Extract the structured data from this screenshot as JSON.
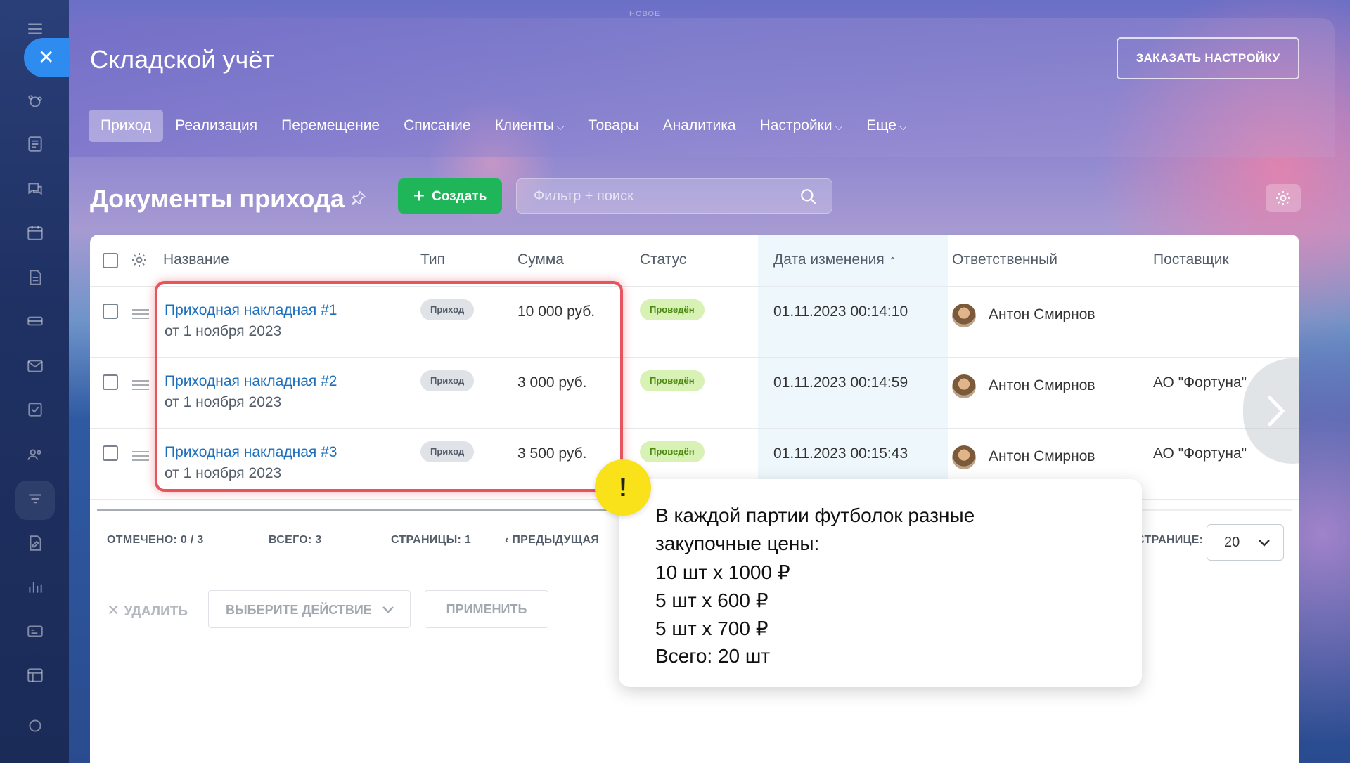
{
  "top_tag": "НОВОЕ",
  "panel": {
    "title": "Складской учёт",
    "order_setup_label": "ЗАКАЗАТЬ НАСТРОЙКУ"
  },
  "tabs": [
    {
      "label": "Приход",
      "active": true
    },
    {
      "label": "Реализация"
    },
    {
      "label": "Перемещение"
    },
    {
      "label": "Списание"
    },
    {
      "label": "Клиенты",
      "dropdown": true
    },
    {
      "label": "Товары"
    },
    {
      "label": "Аналитика"
    },
    {
      "label": "Настройки",
      "dropdown": true
    },
    {
      "label": "Еще",
      "dropdown": true
    }
  ],
  "section": {
    "title": "Документы прихода",
    "create_label": "Создать",
    "search_placeholder": "Фильтр + поиск"
  },
  "table": {
    "headers": {
      "name": "Название",
      "type": "Тип",
      "sum": "Сумма",
      "status": "Статус",
      "date": "Дата изменения",
      "responsible": "Ответственный",
      "supplier": "Поставщик"
    },
    "rows": [
      {
        "name": "Приходная накладная #1",
        "date_sub": "от 1 ноября 2023",
        "type": "Приход",
        "sum": "10 000 руб.",
        "status": "Проведён",
        "modified": "01.11.2023 00:14:10",
        "responsible": "Антон Смирнов",
        "supplier": ""
      },
      {
        "name": "Приходная накладная #2",
        "date_sub": "от 1 ноября 2023",
        "type": "Приход",
        "sum": "3 000 руб.",
        "status": "Проведён",
        "modified": "01.11.2023 00:14:59",
        "responsible": "Антон Смирнов",
        "supplier": "АО \"Фортуна\""
      },
      {
        "name": "Приходная накладная #3",
        "date_sub": "от 1 ноября 2023",
        "type": "Приход",
        "sum": "3 500 руб.",
        "status": "Проведён",
        "modified": "01.11.2023 00:15:43",
        "responsible": "Антон Смирнов",
        "supplier": "АО \"Фортуна\""
      }
    ]
  },
  "footer": {
    "selected": "ОТМЕЧЕНО: 0 / 3",
    "total": "ВСЕГО: 3",
    "pages": "СТРАНИЦЫ:  1",
    "prev": "ПРЕДЫДУЩАЯ",
    "per_page_label": "СТРАНИЦЕ:",
    "per_page_value": "20"
  },
  "actions": {
    "delete_label": "УДАЛИТЬ",
    "select_action_label": "ВЫБЕРИТЕ ДЕЙСТВИЕ",
    "apply_label": "ПРИМЕНИТЬ"
  },
  "tooltip": {
    "badge": "!",
    "lines": [
      "В каждой партии футболок разные",
      "закупочные цены:",
      "10 шт х 1000 ₽",
      "5 шт х 600 ₽",
      "5 шт х 700 ₽",
      "Всего: 20 шт"
    ]
  },
  "colors": {
    "accent": "#2e8cf0",
    "create_green": "#1fb65a",
    "link_blue": "#1d6fbd",
    "status_green": "#d7f2b4",
    "highlight_red": "#e8545e",
    "warn_yellow": "#f9e21a"
  }
}
